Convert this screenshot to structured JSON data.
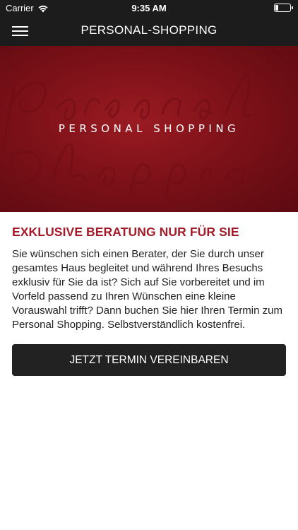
{
  "status_bar": {
    "carrier": "Carrier",
    "time": "9:35 AM",
    "icons": [
      "wifi-icon",
      "battery-icon"
    ]
  },
  "nav": {
    "title": "PERSONAL-SHOPPING",
    "menu_icon": "hamburger-menu-icon"
  },
  "hero": {
    "title": "PERSONAL SHOPPING",
    "watermark": "Personal Shopping",
    "color": "#8a141c"
  },
  "content": {
    "heading": "EXKLUSIVE BERATUNG NUR FÜR SIE",
    "body": "Sie wünschen sich einen Berater, der Sie durch unser gesamtes Haus begleitet und während Ihres Besuchs exklusiv für Sie da ist? Sich auf Sie vorbereitet und im Vorfeld passend zu Ihren Wünschen eine kleine Vorauswahl trifft? Dann buchen Sie hier Ihren Termin zum Personal Shopping. Selbstverständlich kostenfrei.",
    "button_label": "JETZT TERMIN VEREINBAREN"
  },
  "colors": {
    "accent": "#a41c2a",
    "bar": "#1c1c1c",
    "button": "#222222"
  }
}
